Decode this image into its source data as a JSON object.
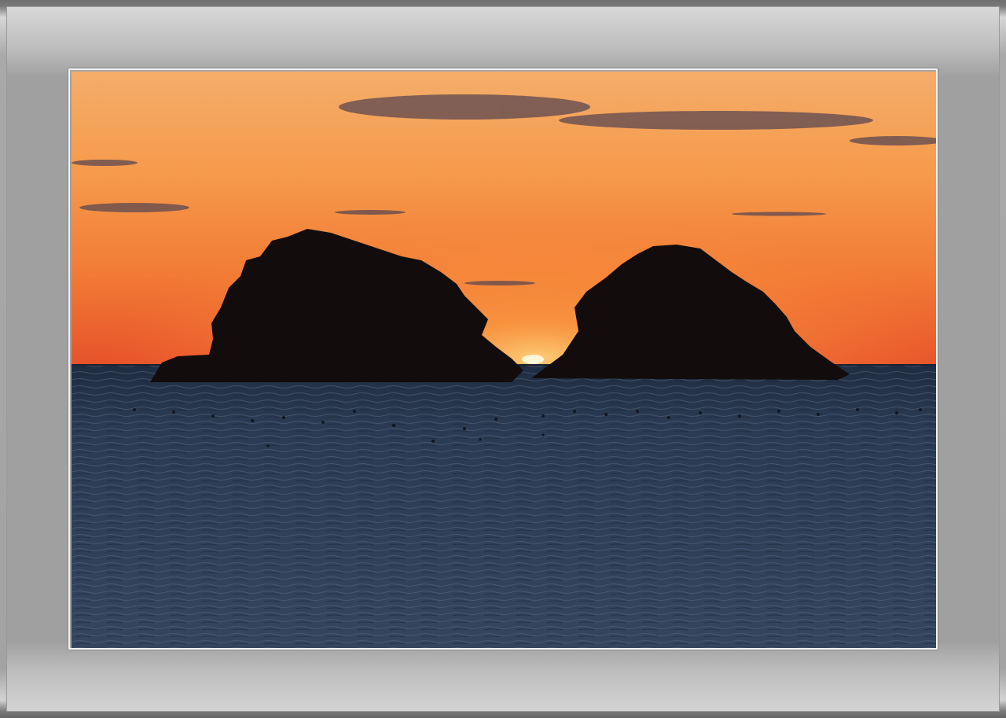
{
  "scene": {
    "description_tokens": [],
    "colors": {
      "sky_top": "#f0a35c",
      "sky_mid": "#f58a3a",
      "sky_horizon": "#e9542a",
      "sun": "#fff6d8",
      "sea_top": "#2c3b52",
      "sea_bottom": "#36465e",
      "island": "#120d0c",
      "cloud": "#5a4a55",
      "mat": "#a6a6a6",
      "mat_line": "#f2f2f2"
    },
    "icons": {
      "left_island": "island-silhouette-icon",
      "right_island": "island-silhouette-icon",
      "sun": "setting-sun-icon"
    }
  }
}
